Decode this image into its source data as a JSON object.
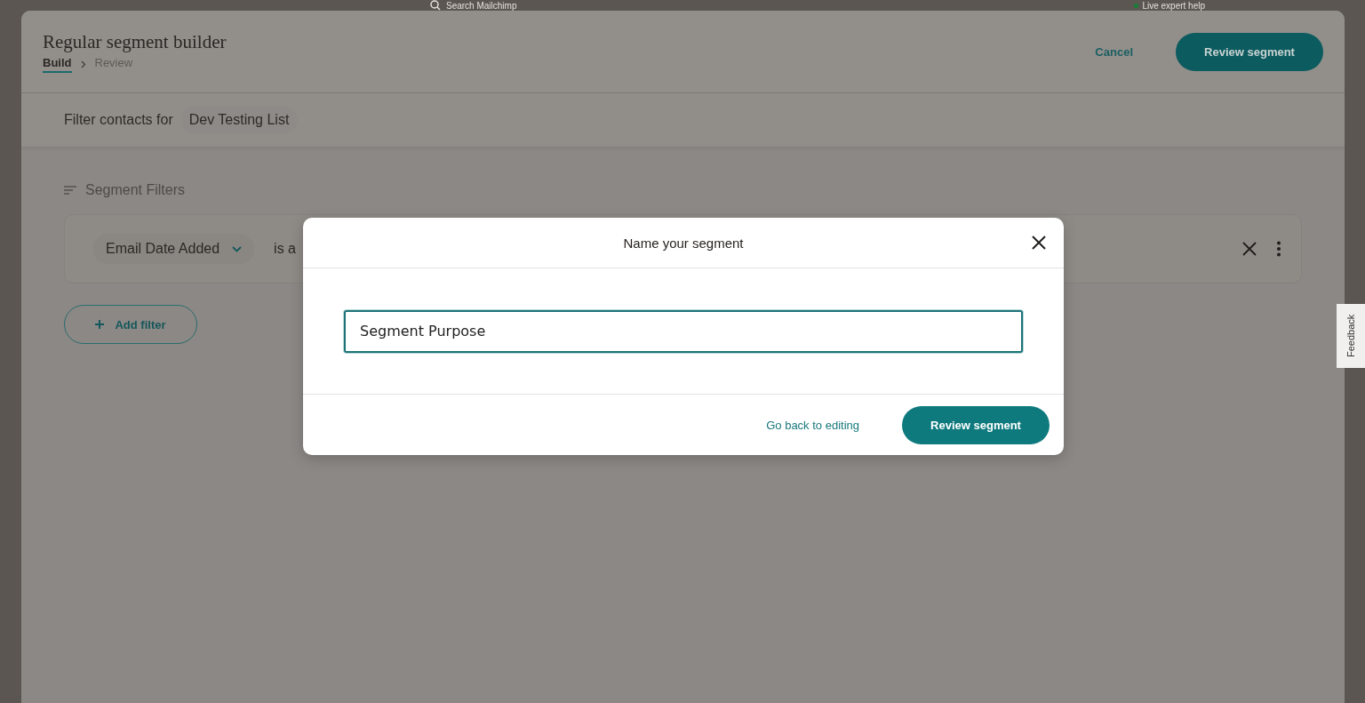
{
  "top_bar": {
    "search": {
      "placeholder": "Search Mailchimp"
    },
    "help_link": "Live expert help"
  },
  "page": {
    "title": "Regular segment builder",
    "steps": [
      {
        "label": "Build",
        "selected": true
      },
      {
        "label": "Review",
        "selected": false
      }
    ],
    "cancel": "Cancel",
    "primary": "Review segment"
  },
  "audience": {
    "label": "Filter contacts for",
    "value": "Dev Testing List"
  },
  "filters": {
    "title": "Segment Filters",
    "rows": [
      {
        "field": "Email Date Added",
        "operator": "is a"
      }
    ],
    "add": "Add filter"
  },
  "dialog": {
    "title": "Name your segment",
    "input": {
      "value": "Segment Purpose"
    },
    "secondary": "Go back to editing",
    "primary": "Review segment"
  },
  "feedback": "Feedback"
}
